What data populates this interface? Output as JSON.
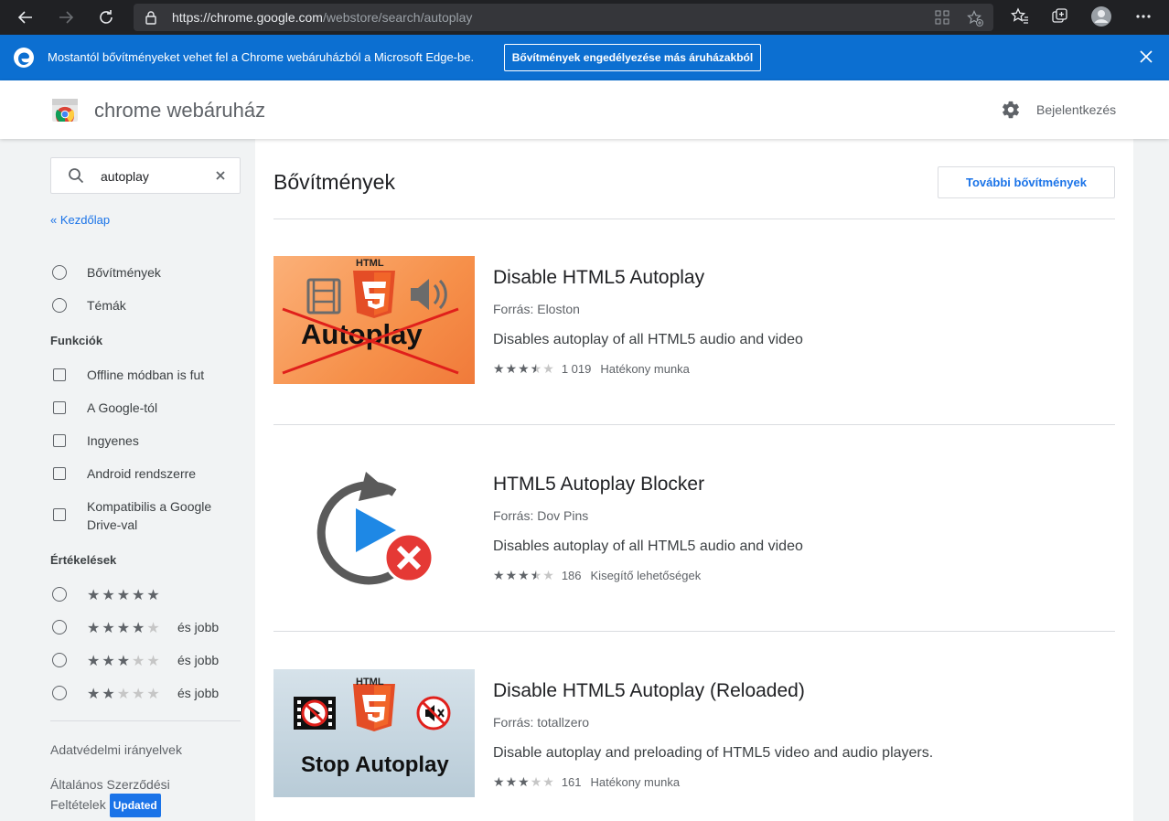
{
  "browser": {
    "url_main": "https://chrome.google.com",
    "url_path": "/webstore/search/autoplay",
    "icons": [
      "back-icon",
      "forward-icon",
      "refresh-icon",
      "lock-icon",
      "apps-icon",
      "favorite-add-icon",
      "favorites-icon",
      "collections-icon",
      "profile-icon",
      "more-icon"
    ]
  },
  "banner": {
    "message": "Mostantól bővítményeket vehet fel a Chrome webáruházból a Microsoft Edge-be.",
    "allow_button": "Bővítmények engedélyezése más áruházakból"
  },
  "header": {
    "store_title": "chrome webáruház",
    "signin": "Bejelentkezés"
  },
  "sidebar": {
    "search_value": "autoplay",
    "home_link": "« Kezdőlap",
    "type_options": [
      "Bővítmények",
      "Témák"
    ],
    "features_heading": "Funkciók",
    "features": [
      "Offline módban is fut",
      "A Google-tól",
      "Ingyenes",
      "Android rendszerre",
      "Kompatibilis a Google Drive-val"
    ],
    "ratings_heading": "Értékelések",
    "rating_options": [
      {
        "stars": 5,
        "suffix": ""
      },
      {
        "stars": 4,
        "suffix": "és jobb"
      },
      {
        "stars": 3,
        "suffix": "és jobb"
      },
      {
        "stars": 2,
        "suffix": "és jobb"
      }
    ],
    "privacy_link": "Adatvédelmi irányelvek",
    "terms_link": "Általános Szerződési Feltételek",
    "terms_badge": "Updated"
  },
  "main": {
    "title": "Bővítmények",
    "more_button": "További bővítmények",
    "items": [
      {
        "name": "Disable HTML5 Autoplay",
        "source": "Forrás: Eloston",
        "description": "Disables autoplay of all HTML5 audio and video",
        "rating": 3.5,
        "count": "1 019",
        "category": "Hatékony munka",
        "thumb_label": "Autoplay",
        "thumb_badge": "HTML"
      },
      {
        "name": "HTML5 Autoplay Blocker",
        "source": "Forrás: Dov Pins",
        "description": "Disables autoplay of all HTML5 audio and video",
        "rating": 3.5,
        "count": "186",
        "category": "Kisegítő lehetőségek"
      },
      {
        "name": "Disable HTML5 Autoplay (Reloaded)",
        "source": "Forrás: totallzero",
        "description": "Disable autoplay and preloading of HTML5 video and audio players.",
        "rating": 3,
        "count": "161",
        "category": "Hatékony munka",
        "thumb_label": "Stop Autoplay",
        "thumb_badge": "HTML"
      }
    ]
  },
  "colors": {
    "browser_bar": "#202124",
    "banner": "#0c6fd1",
    "accent": "#1a73e8",
    "html5_orange": "#e44d26"
  }
}
